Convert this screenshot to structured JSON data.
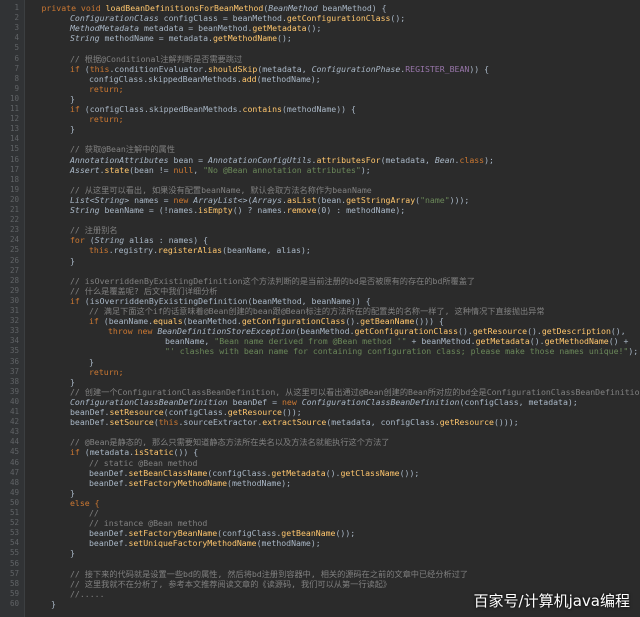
{
  "colors": {
    "background": "#2b2b2b",
    "keyword": "#cc7832",
    "method": "#ffc66d",
    "call": "#a9b7c6",
    "type": "#a9b7c6",
    "string": "#6a8759",
    "comment": "#808080",
    "constant": "#9876aa"
  },
  "editor": {
    "lines": [
      {
        "n": "1",
        "indent": 1,
        "text": "private void loadBeanDefinitionsForBeanMethod(BeanMethod beanMethod) {",
        "kind": "sig"
      },
      {
        "n": "2",
        "indent": 4,
        "text": "ConfigurationClass configClass = beanMethod.getConfigurationClass();",
        "kind": "code"
      },
      {
        "n": "3",
        "indent": 4,
        "text": "MethodMetadata metadata = beanMethod.getMetadata();",
        "kind": "code"
      },
      {
        "n": "4",
        "indent": 4,
        "text": "String methodName = metadata.getMethodName();",
        "kind": "code"
      },
      {
        "n": "5",
        "indent": 0,
        "text": "",
        "kind": "code"
      },
      {
        "n": "6",
        "indent": 4,
        "text": "// 根据@Conditional注解判断是否需要跳过",
        "kind": "comment"
      },
      {
        "n": "7",
        "indent": 4,
        "text": "if (this.conditionEvaluator.shouldSkip(metadata, ConfigurationPhase.REGISTER_BEAN)) {",
        "kind": "code"
      },
      {
        "n": "8",
        "indent": 6,
        "text": "configClass.skippedBeanMethods.add(methodName);",
        "kind": "code"
      },
      {
        "n": "9",
        "indent": 6,
        "text": "return;",
        "kind": "keyword"
      },
      {
        "n": "10",
        "indent": 4,
        "text": "}",
        "kind": "code"
      },
      {
        "n": "11",
        "indent": 4,
        "text": "if (configClass.skippedBeanMethods.contains(methodName)) {",
        "kind": "code"
      },
      {
        "n": "12",
        "indent": 6,
        "text": "return;",
        "kind": "keyword"
      },
      {
        "n": "13",
        "indent": 4,
        "text": "}",
        "kind": "code"
      },
      {
        "n": "14",
        "indent": 0,
        "text": "",
        "kind": "code"
      },
      {
        "n": "15",
        "indent": 4,
        "text": "// 获取@Bean注解中的属性",
        "kind": "comment"
      },
      {
        "n": "16",
        "indent": 4,
        "text": "AnnotationAttributes bean = AnnotationConfigUtils.attributesFor(metadata, Bean.class);",
        "kind": "code"
      },
      {
        "n": "17",
        "indent": 4,
        "text": "Assert.state(bean != null, \"No @Bean annotation attributes\");",
        "kind": "code"
      },
      {
        "n": "18",
        "indent": 0,
        "text": "",
        "kind": "code"
      },
      {
        "n": "19",
        "indent": 4,
        "text": "// 从这里可以看出, 如果没有配置beanName, 默认会取方法名称作为beanName",
        "kind": "comment"
      },
      {
        "n": "20",
        "indent": 4,
        "text": "List<String> names = new ArrayList<>(Arrays.asList(bean.getStringArray(\"name\")));",
        "kind": "code"
      },
      {
        "n": "21",
        "indent": 4,
        "text": "String beanName = (!names.isEmpty() ? names.remove(0) : methodName);",
        "kind": "code"
      },
      {
        "n": "22",
        "indent": 0,
        "text": "",
        "kind": "code"
      },
      {
        "n": "23",
        "indent": 4,
        "text": "// 注册别名",
        "kind": "comment"
      },
      {
        "n": "24",
        "indent": 4,
        "text": "for (String alias : names) {",
        "kind": "code"
      },
      {
        "n": "25",
        "indent": 6,
        "text": "this.registry.registerAlias(beanName, alias);",
        "kind": "code"
      },
      {
        "n": "26",
        "indent": 4,
        "text": "}",
        "kind": "code"
      },
      {
        "n": "27",
        "indent": 0,
        "text": "",
        "kind": "code"
      },
      {
        "n": "28",
        "indent": 4,
        "text": "// isOverriddenByExistingDefinition这个方法判断的是当前注册的bd是否被原有的存在的bd所覆盖了",
        "kind": "comment"
      },
      {
        "n": "29",
        "indent": 4,
        "text": "// 什么是覆盖呢? 后文中我们详细分析",
        "kind": "comment"
      },
      {
        "n": "30",
        "indent": 4,
        "text": "if (isOverriddenByExistingDefinition(beanMethod, beanName)) {",
        "kind": "code"
      },
      {
        "n": "31",
        "indent": 6,
        "text": "// 满足下面这个if的话意味着@Bean创建的bean跟@Bean标注的方法所在的配置类的名称一样了, 这种情况下直接抛出异常",
        "kind": "comment"
      },
      {
        "n": "32",
        "indent": 6,
        "text": "if (beanName.equals(beanMethod.getConfigurationClass().getBeanName())) {",
        "kind": "code"
      },
      {
        "n": "33",
        "indent": 8,
        "text": "throw new BeanDefinitionStoreException(beanMethod.getConfigurationClass().getResource().getDescription(),",
        "kind": "code"
      },
      {
        "n": "34",
        "indent": 14,
        "text": "beanName, \"Bean name derived from @Bean method '\" + beanMethod.getMetadata().getMethodName() +",
        "kind": "code"
      },
      {
        "n": "35",
        "indent": 14,
        "text": "\"' clashes with bean name for containing configuration class; please make those names unique!\");",
        "kind": "string"
      },
      {
        "n": "36",
        "indent": 6,
        "text": "}",
        "kind": "code"
      },
      {
        "n": "37",
        "indent": 6,
        "text": "return;",
        "kind": "keyword"
      },
      {
        "n": "38",
        "indent": 4,
        "text": "}",
        "kind": "code"
      },
      {
        "n": "39",
        "indent": 4,
        "text": "// 创建一个ConfigurationClassBeanDefinition, 从这里可以看出通过@Bean创建的Bean所对应的bd全是ConfigurationClassBeanDefinition",
        "kind": "comment"
      },
      {
        "n": "40",
        "indent": 4,
        "text": "ConfigurationClassBeanDefinition beanDef = new ConfigurationClassBeanDefinition(configClass, metadata);",
        "kind": "code"
      },
      {
        "n": "41",
        "indent": 4,
        "text": "beanDef.setResource(configClass.getResource());",
        "kind": "code"
      },
      {
        "n": "42",
        "indent": 4,
        "text": "beanDef.setSource(this.sourceExtractor.extractSource(metadata, configClass.getResource()));",
        "kind": "code"
      },
      {
        "n": "43",
        "indent": 0,
        "text": "",
        "kind": "code"
      },
      {
        "n": "44",
        "indent": 4,
        "text": "// @Bean是静态的, 那么只需要知道静态方法所在类名以及方法名就能执行这个方法了",
        "kind": "comment"
      },
      {
        "n": "45",
        "indent": 4,
        "text": "if (metadata.isStatic()) {",
        "kind": "code"
      },
      {
        "n": "46",
        "indent": 6,
        "text": "// static @Bean method",
        "kind": "comment"
      },
      {
        "n": "47",
        "indent": 6,
        "text": "beanDef.setBeanClassName(configClass.getMetadata().getClassName());",
        "kind": "code"
      },
      {
        "n": "48",
        "indent": 6,
        "text": "beanDef.setFactoryMethodName(methodName);",
        "kind": "code"
      },
      {
        "n": "49",
        "indent": 4,
        "text": "}",
        "kind": "code"
      },
      {
        "n": "50",
        "indent": 4,
        "text": "else {",
        "kind": "keyword"
      },
      {
        "n": "51",
        "indent": 6,
        "text": "//",
        "kind": "comment"
      },
      {
        "n": "52",
        "indent": 6,
        "text": "// instance @Bean method",
        "kind": "comment"
      },
      {
        "n": "53",
        "indent": 6,
        "text": "beanDef.setFactoryBeanName(configClass.getBeanName());",
        "kind": "code"
      },
      {
        "n": "54",
        "indent": 6,
        "text": "beanDef.setUniqueFactoryMethodName(methodName);",
        "kind": "code"
      },
      {
        "n": "55",
        "indent": 4,
        "text": "}",
        "kind": "code"
      },
      {
        "n": "56",
        "indent": 0,
        "text": "",
        "kind": "code"
      },
      {
        "n": "57",
        "indent": 4,
        "text": "// 接下来的代码就是设置一些bd的属性, 然后将bd注册到容器中, 相关的源码在之前的文章中已经分析过了",
        "kind": "comment"
      },
      {
        "n": "58",
        "indent": 4,
        "text": "// 这里我就不在分析了, 参考本文推荐阅读文章的《读源码, 我们可以从第一行读起》",
        "kind": "comment"
      },
      {
        "n": "59",
        "indent": 4,
        "text": "//.....",
        "kind": "comment"
      },
      {
        "n": "60",
        "indent": 2,
        "text": "}",
        "kind": "code"
      }
    ]
  },
  "watermark": {
    "text": "百家号/计算机java编程"
  }
}
